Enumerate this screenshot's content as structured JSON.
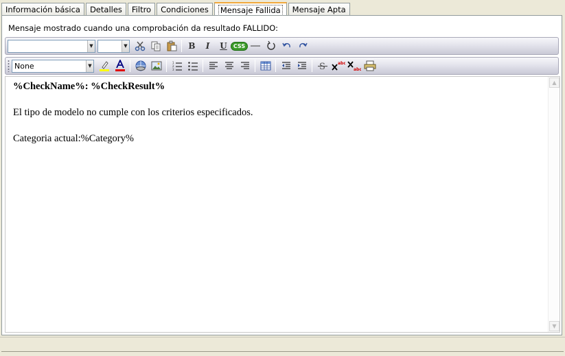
{
  "tabs": [
    {
      "label": "Información básica",
      "active": false
    },
    {
      "label": "Detalles",
      "active": false
    },
    {
      "label": "Filtro",
      "active": false
    },
    {
      "label": "Condiciones",
      "active": false
    },
    {
      "label": "Mensaje Fallida",
      "active": true
    },
    {
      "label": "Mensaje Apta",
      "active": false
    }
  ],
  "instruction": "Mensaje mostrado cuando una comprobación da resultado FALLIDO:",
  "toolbar1": {
    "font_name_value": "",
    "font_size_value": "",
    "bold_label": "B",
    "italic_label": "I",
    "underline_label": "U",
    "css_label": "CSS"
  },
  "toolbar2": {
    "style_value": "None"
  },
  "editor": {
    "heading": "%CheckName%: %CheckResult%",
    "line1": "El tipo de modelo no cumple con los criterios especificados.",
    "line2": "Categoria actual:%Category%"
  }
}
